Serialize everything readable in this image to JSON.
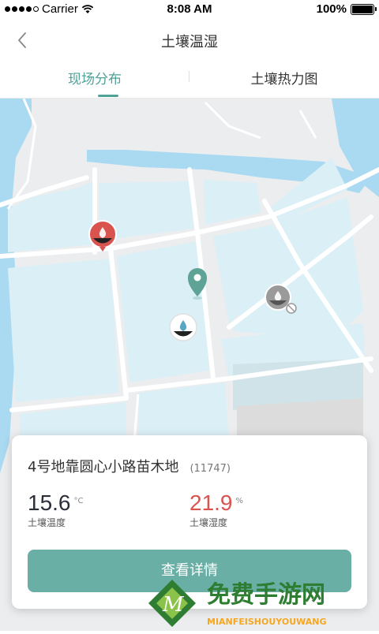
{
  "status_bar": {
    "carrier": "Carrier",
    "time": "8:08 AM",
    "battery": "100%"
  },
  "nav": {
    "title": "土壤温湿"
  },
  "tabs": [
    {
      "label": "现场分布",
      "active": true
    },
    {
      "label": "土壤热力图",
      "active": false
    }
  ],
  "card": {
    "title": "4号地靠圆心小路苗木地",
    "code": "(11747)",
    "temperature": {
      "value": "15.6",
      "unit": "°C",
      "label": "土壤温度",
      "color": "#2b2f3a"
    },
    "humidity": {
      "value": "21.9",
      "unit": "%",
      "label": "土壤湿度",
      "color": "#d9534f"
    },
    "button_label": "查看详情"
  },
  "markers": [
    {
      "name": "red-sensor-marker",
      "color": "#d9534f"
    },
    {
      "name": "location-pin",
      "color": "#5fa396"
    },
    {
      "name": "gray-sensor-marker",
      "color": "#9a9a9a"
    },
    {
      "name": "white-sensor-marker",
      "color": "#ffffff"
    }
  ],
  "watermark": {
    "text": "免费手游网",
    "subtext": "MIANFEISHOUYOUWANG"
  },
  "colors": {
    "accent": "#4fa297",
    "water": "#a9daf2",
    "parcel": "#dbeff6",
    "road": "#ffffff"
  }
}
